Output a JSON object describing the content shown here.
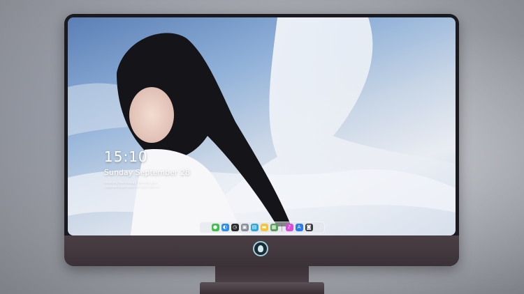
{
  "lock_screen": {
    "time": "15:10",
    "date": "Sunday September 28",
    "tip": "Intensity technology. Elevate your creative experience on your device."
  },
  "dock": {
    "apps": [
      {
        "name": "messages-icon",
        "glyph": "●",
        "color": "#3fc04a"
      },
      {
        "name": "finder-icon",
        "glyph": "◐",
        "color": "#2f8ee6"
      },
      {
        "name": "clock-icon",
        "glyph": "◷",
        "color": "#2b2b2b"
      },
      {
        "name": "preview-icon",
        "glyph": "▣",
        "color": "#8a8f99"
      },
      {
        "name": "claquette-icon",
        "glyph": "▤",
        "color": "#2fa6d6"
      },
      {
        "name": "notes-icon",
        "glyph": "▬",
        "color": "#f2c53d"
      },
      {
        "name": "photos-viewer-icon",
        "glyph": "▦",
        "color": "#5a9e5a"
      },
      {
        "name": "music-icon",
        "glyph": "♪",
        "color": "#d64fd8"
      },
      {
        "name": "app-store-icon",
        "glyph": "A",
        "color": "#2b7de9"
      },
      {
        "name": "camera-icon",
        "glyph": "◙",
        "color": "#3a3a3f"
      }
    ]
  }
}
